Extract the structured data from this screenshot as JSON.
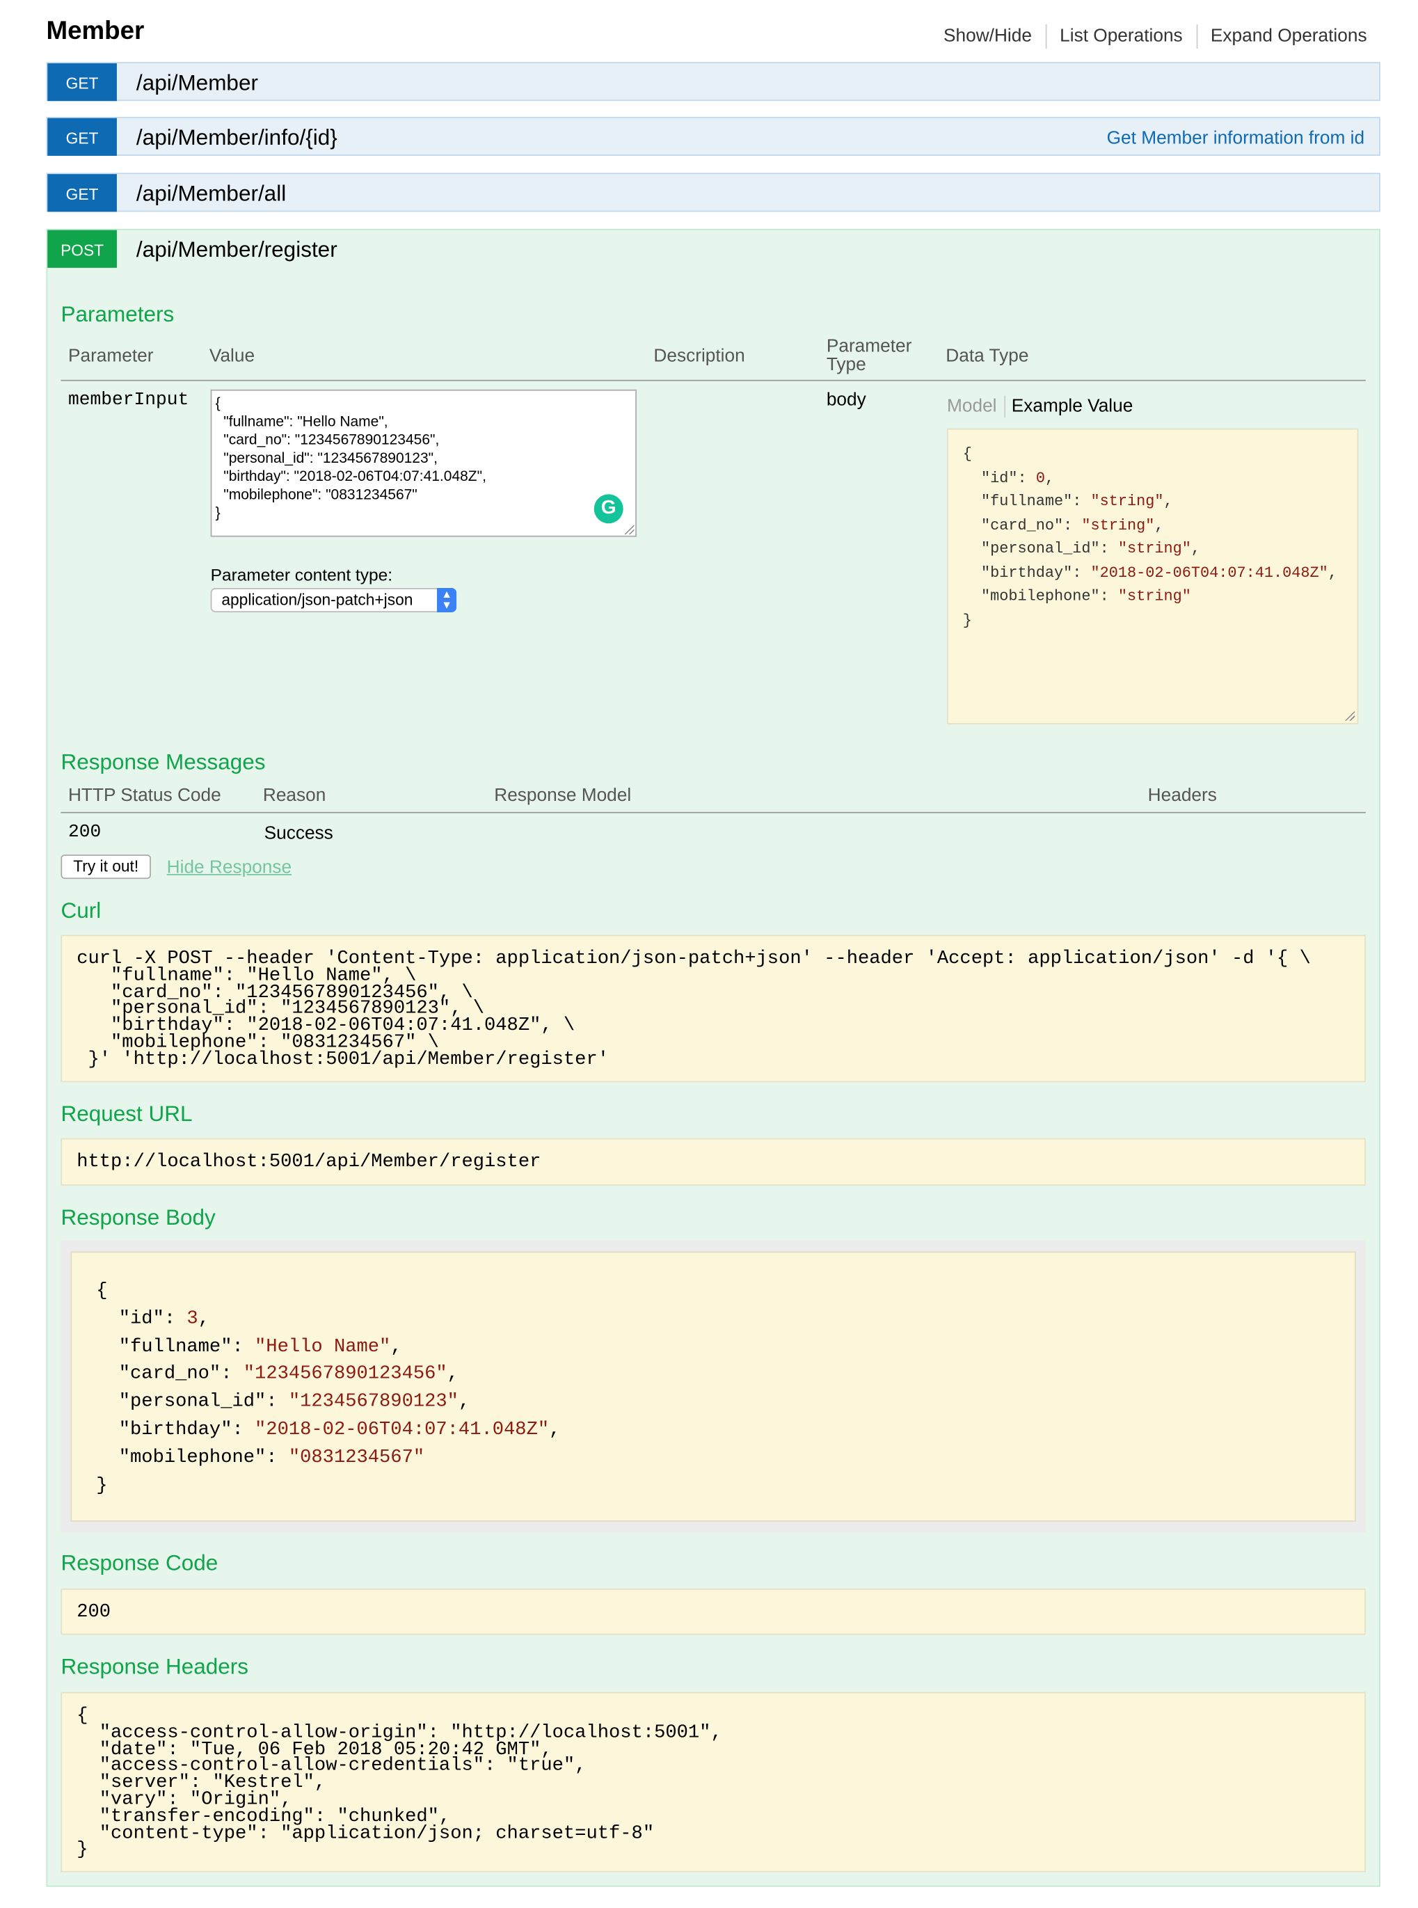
{
  "resource": {
    "title": "Member",
    "links": [
      "Show/Hide",
      "List Operations",
      "Expand Operations"
    ]
  },
  "operations": [
    {
      "verb": "GET",
      "path": "/api/Member",
      "summary": ""
    },
    {
      "verb": "GET",
      "path": "/api/Member/info/{id}",
      "summary": "Get Member information from id"
    },
    {
      "verb": "GET",
      "path": "/api/Member/all",
      "summary": ""
    },
    {
      "verb": "POST",
      "path": "/api/Member/register",
      "summary": ""
    }
  ],
  "parameters": {
    "heading": "Parameters",
    "columns": {
      "parameter": "Parameter",
      "value": "Value",
      "description": "Description",
      "param_type_line1": "Parameter",
      "param_type_line2": "Type",
      "data_type": "Data Type"
    },
    "row": {
      "name": "memberInput",
      "value": "{\n  \"fullname\": \"Hello Name\",\n  \"card_no\": \"1234567890123456\",\n  \"personal_id\": \"1234567890123\",\n  \"birthday\": \"2018-02-06T04:07:41.048Z\",\n  \"mobilephone\": \"0831234567\"\n}",
      "param_type": "body",
      "content_type_label": "Parameter content type:",
      "content_type_value": "application/json-patch+json",
      "model_tab": "Model",
      "example_tab": "Example Value",
      "example": {
        "open": "{",
        "close": "}",
        "lines": [
          {
            "key": "\"id\"",
            "value": "0",
            "kind": "num"
          },
          {
            "key": "\"fullname\"",
            "value": "\"string\"",
            "kind": "str"
          },
          {
            "key": "\"card_no\"",
            "value": "\"string\"",
            "kind": "str"
          },
          {
            "key": "\"personal_id\"",
            "value": "\"string\"",
            "kind": "str"
          },
          {
            "key": "\"birthday\"",
            "value": "\"2018-02-06T04:07:41.048Z\"",
            "kind": "str"
          },
          {
            "key": "\"mobilephone\"",
            "value": "\"string\"",
            "kind": "str"
          }
        ]
      }
    }
  },
  "response_messages": {
    "heading": "Response Messages",
    "columns": [
      "HTTP Status Code",
      "Reason",
      "Response Model",
      "Headers"
    ],
    "rows": [
      {
        "code": "200",
        "reason": "Success"
      }
    ]
  },
  "actions": {
    "try_it": "Try it out!",
    "hide_response": "Hide Response"
  },
  "curl": {
    "heading": "Curl",
    "text": "curl -X POST --header 'Content-Type: application/json-patch+json' --header 'Accept: application/json' -d '{ \\\n   \"fullname\": \"Hello Name\", \\\n   \"card_no\": \"1234567890123456\", \\\n   \"personal_id\": \"1234567890123\", \\\n   \"birthday\": \"2018-02-06T04:07:41.048Z\", \\\n   \"mobilephone\": \"0831234567\" \\\n }' 'http://localhost:5001/api/Member/register'"
  },
  "request_url": {
    "heading": "Request URL",
    "value": "http://localhost:5001/api/Member/register"
  },
  "response_body": {
    "heading": "Response Body",
    "open": "{",
    "close": "}",
    "lines": [
      {
        "key": "\"id\"",
        "value": "3",
        "kind": "num"
      },
      {
        "key": "\"fullname\"",
        "value": "\"Hello Name\"",
        "kind": "str"
      },
      {
        "key": "\"card_no\"",
        "value": "\"1234567890123456\"",
        "kind": "str"
      },
      {
        "key": "\"personal_id\"",
        "value": "\"1234567890123\"",
        "kind": "str"
      },
      {
        "key": "\"birthday\"",
        "value": "\"2018-02-06T04:07:41.048Z\"",
        "kind": "str"
      },
      {
        "key": "\"mobilephone\"",
        "value": "\"0831234567\"",
        "kind": "str"
      }
    ]
  },
  "response_code": {
    "heading": "Response Code",
    "value": "200"
  },
  "response_headers": {
    "heading": "Response Headers",
    "text": "{\n  \"access-control-allow-origin\": \"http://localhost:5001\",\n  \"date\": \"Tue, 06 Feb 2018 05:20:42 GMT\",\n  \"access-control-allow-credentials\": \"true\",\n  \"server\": \"Kestrel\",\n  \"vary\": \"Origin\",\n  \"transfer-encoding\": \"chunked\",\n  \"content-type\": \"application/json; charset=utf-8\"\n}"
  },
  "colors": {
    "get": "#0f6ab4",
    "post": "#10a54a",
    "section_heading": "#10a54a",
    "code_bg": "#fcf6db",
    "string_value": "#8b1a10"
  }
}
